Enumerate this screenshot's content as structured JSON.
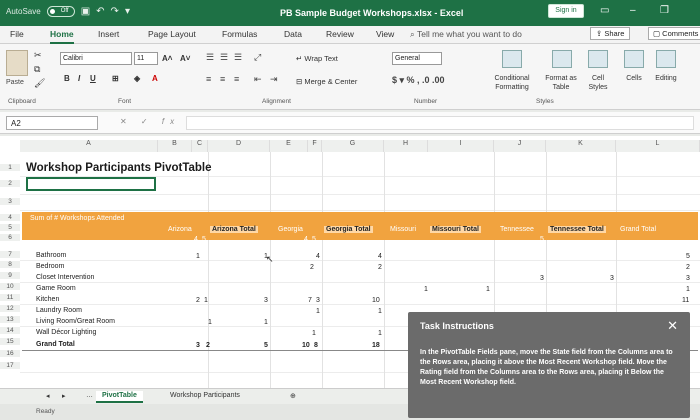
{
  "title_bar": {
    "autosave_label": "AutoSave",
    "autosave_state": "Off",
    "document_title": "PB Sample Budget Workshops.xlsx - Excel",
    "sign_in": "Sign in"
  },
  "menu_tabs": [
    "File",
    "Home",
    "Insert",
    "Page Layout",
    "Formulas",
    "Data",
    "Review",
    "View"
  ],
  "active_tab": "Home",
  "tell_me": "Tell me what you want to do",
  "share_label": "Share",
  "comments_label": "Comments",
  "ribbon": {
    "paste": "Paste",
    "clipboard": "Clipboard",
    "font_name": "Calibri",
    "font_size": "11",
    "font_group": "Font",
    "alignment_group": "Alignment",
    "wrap_text": "Wrap Text",
    "merge_center": "Merge & Center",
    "number_format": "General",
    "number_group": "Number",
    "conditional_formatting": "Conditional Formatting",
    "format_as_table": "Format as Table",
    "cell_styles": "Cell Styles",
    "styles_group": "Styles",
    "cells": "Cells",
    "editing": "Editing"
  },
  "formula_bar": {
    "name_box": "A2",
    "fx": "fx"
  },
  "grid": {
    "columns": [
      "A",
      "B",
      "C",
      "D",
      "E",
      "F",
      "G",
      "H",
      "I",
      "J",
      "K",
      "L"
    ],
    "rows": [
      "1",
      "2",
      "3",
      "4",
      "5",
      "6",
      "7",
      "8",
      "9",
      "10",
      "11",
      "12",
      "13",
      "14",
      "15",
      "16",
      "17"
    ],
    "title": "Workshop Participants PivotTable",
    "pivot_corner": "Sum of # Workshops Attended",
    "states": [
      "Arizona",
      "Arizona Total",
      "Georgia",
      "Georgia Total",
      "Missouri",
      "Missouri Total",
      "Tennessee",
      "Tennessee Total",
      "Grand Total"
    ],
    "sub_headers": [
      "4",
      "5",
      "4",
      "5",
      "5"
    ],
    "row_labels": [
      "Bathroom",
      "Bedroom",
      "Closet Intervention",
      "Game Room",
      "Kitchen",
      "Laundry Room",
      "Living Room/Great Room",
      "Wall Décor Lighting",
      "Grand Total"
    ],
    "cells": {
      "az1": "1",
      "az_total1": "1",
      "ga_total1": "4",
      "ga_total2": "4",
      "ga_2": "2",
      "ga_total2b": "2",
      "tn_3": "3",
      "tn_total3": "3",
      "mo_4": "1",
      "mo_total4": "1",
      "az_5a": "2",
      "az_5b": "1",
      "az_total5": "3",
      "ga_5a": "7",
      "ga_5b": "3",
      "ga_total5": "10",
      "ga_6": "1",
      "ga_total6": "1",
      "az_7": "1",
      "az_total7": "1",
      "ga_8": "1",
      "ga_total8": "1",
      "az_gt_a": "3",
      "az_gt_b": "2",
      "az_gt_total": "5",
      "ga_gt_a": "10",
      "ga_gt_b": "8",
      "ga_gt_total": "18",
      "grand": [
        "5",
        "2",
        "3",
        "1",
        "11"
      ]
    }
  },
  "sheet_tabs": [
    "PivotTable",
    "Workshop Participants"
  ],
  "active_sheet": "PivotTable",
  "status": "Ready",
  "task": {
    "title": "Task Instructions",
    "body": "In the PivotTable Fields pane, move the State field from the Columns area to the Rows area, placing it above the Most Recent Workshop field. Move the Rating field from the Columns area to the Rows area, placing it Below the Most Recent Workshop field."
  }
}
